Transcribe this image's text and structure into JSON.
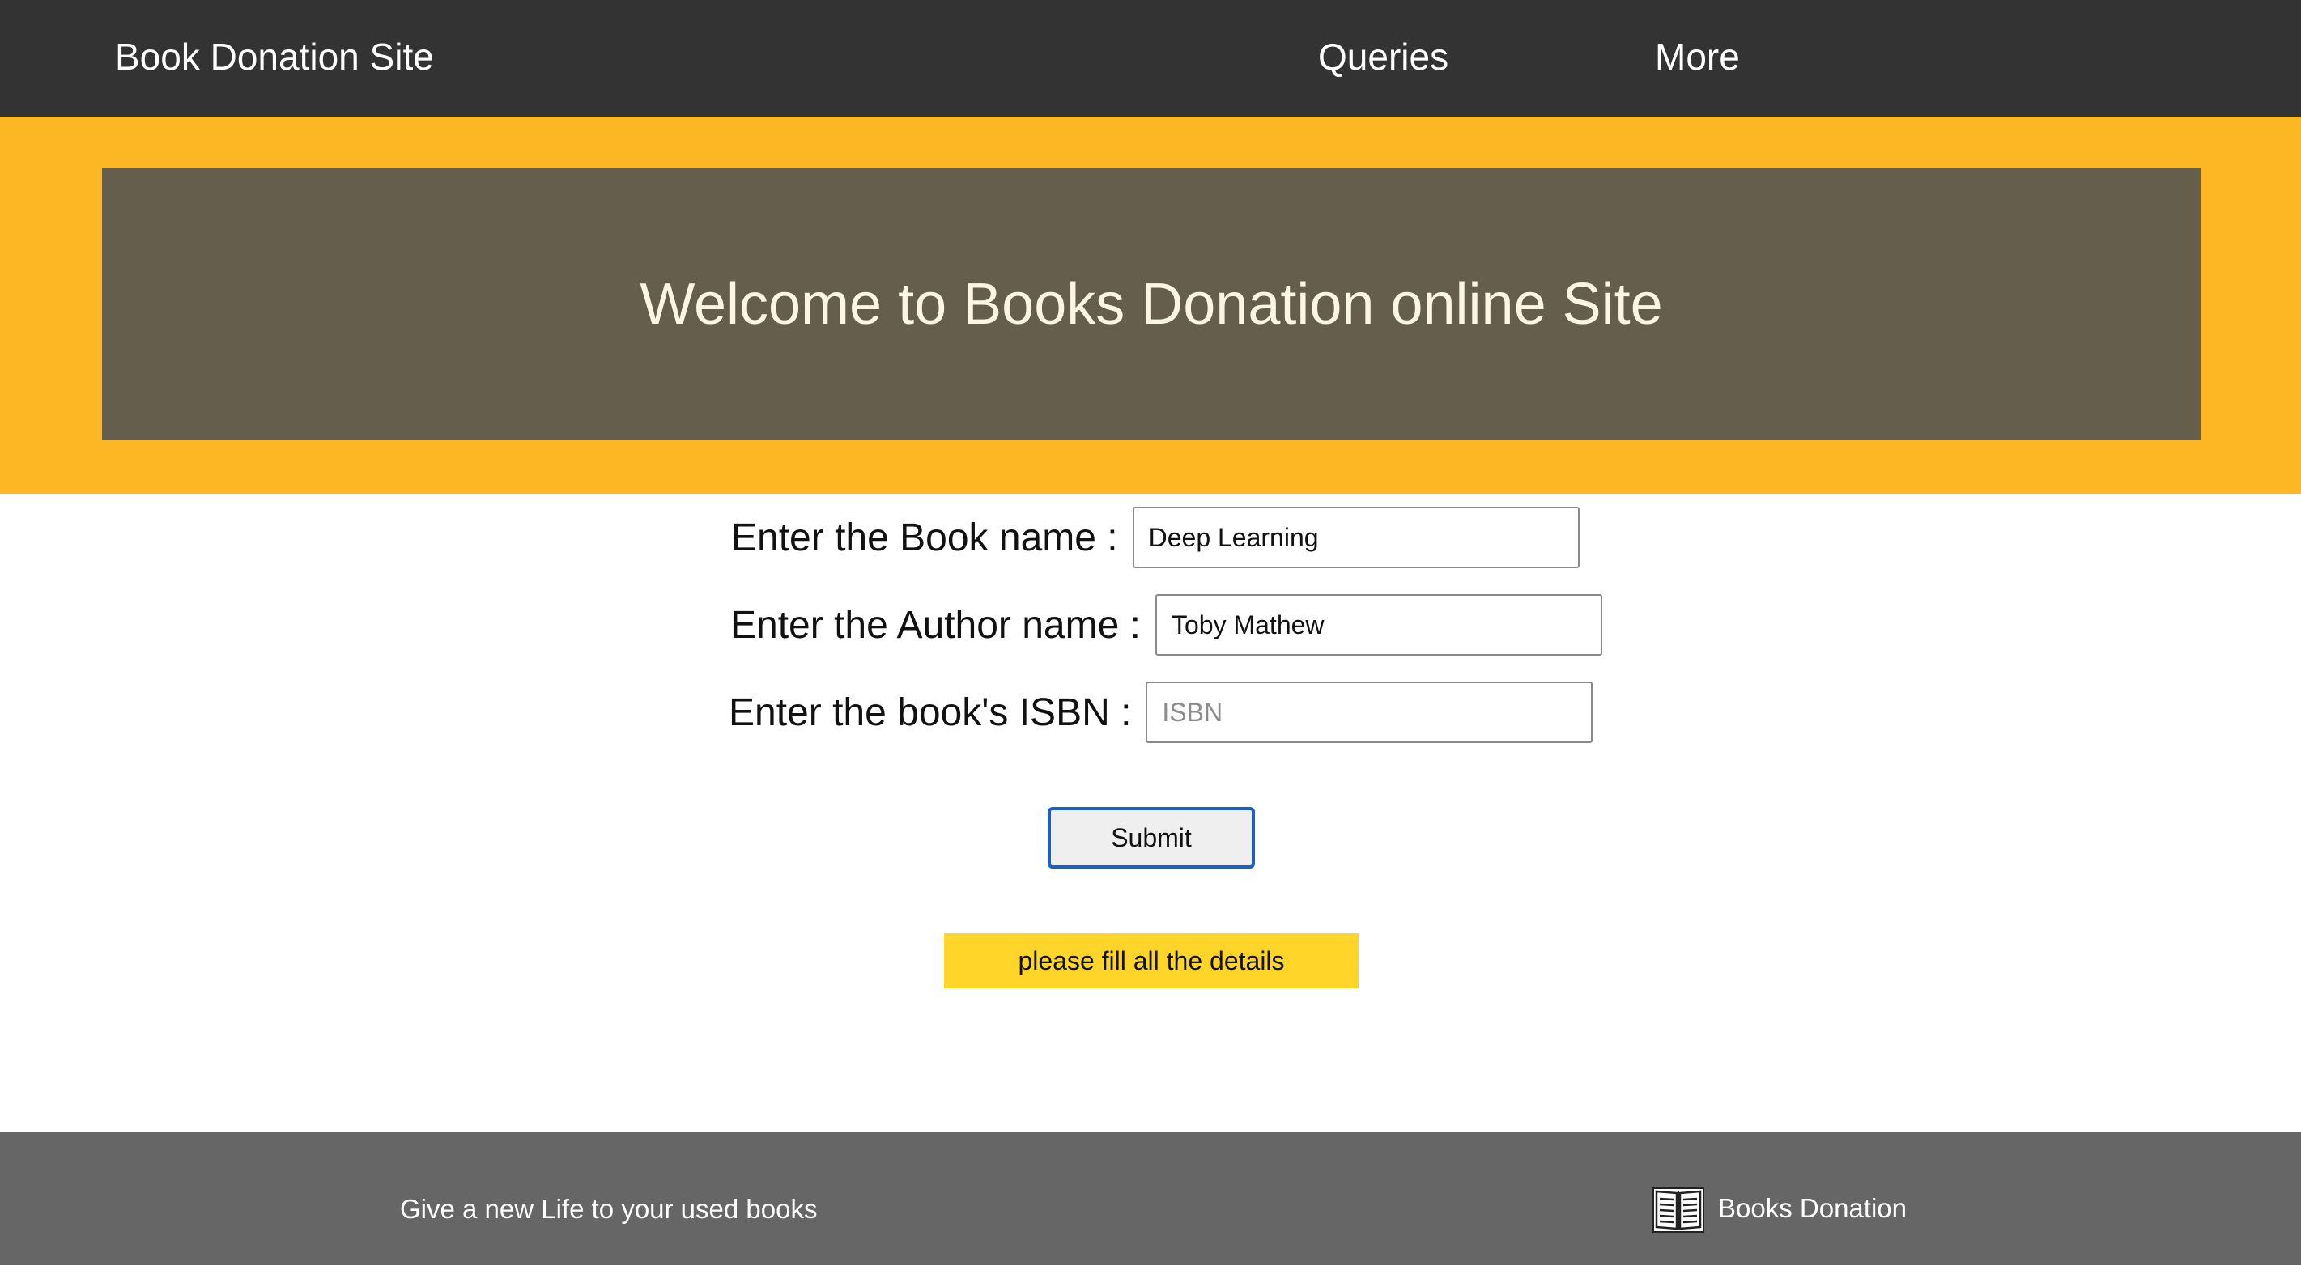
{
  "navbar": {
    "brand": "Book Donation Site",
    "links": [
      "Queries",
      "More"
    ]
  },
  "banner": {
    "title": "Welcome to Books Donation online Site"
  },
  "form": {
    "book_name": {
      "label": "Enter the Book name :",
      "value": "Deep Learning",
      "placeholder": ""
    },
    "author_name": {
      "label": "Enter the Author name :",
      "value": "Toby Mathew",
      "placeholder": ""
    },
    "isbn": {
      "label": "Enter the book's ISBN :",
      "value": "",
      "placeholder": "ISBN"
    },
    "submit_label": "Submit",
    "alert": "please fill all the details"
  },
  "footer": {
    "tagline": "Give a new Life to your used books",
    "brand_icon": "open-book-icon",
    "brand_label": "Books Donation"
  },
  "colors": {
    "navbar": "#333333",
    "banner_outer": "#fdb725",
    "banner_inner": "#655e4c",
    "alert": "#ffd52a",
    "footer": "#666666",
    "focus_border": "#1b5fc7"
  }
}
